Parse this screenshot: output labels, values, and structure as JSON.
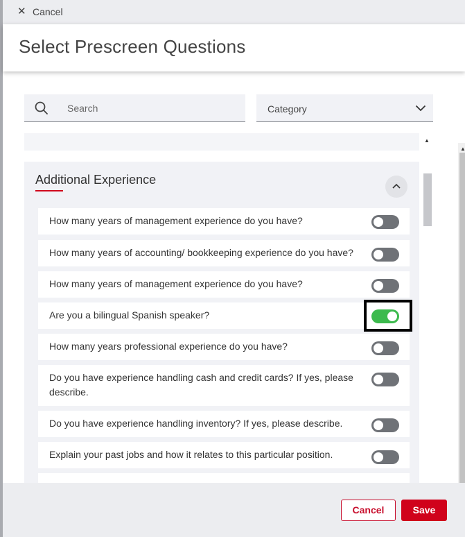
{
  "topbar": {
    "close_glyph": "✕",
    "cancel_label": "Cancel"
  },
  "header": {
    "title": "Select Prescreen Questions"
  },
  "filters": {
    "search_placeholder": "Search",
    "category_label": "Category"
  },
  "section": {
    "title": "Additional Experience",
    "questions": [
      {
        "text": "How many years of management experience do you have?",
        "enabled": false
      },
      {
        "text": "How many years of accounting/ bookkeeping experience do you have?",
        "enabled": false
      },
      {
        "text": "How many years of management experience do you have?",
        "enabled": false
      },
      {
        "text": "Are you a bilingual Spanish speaker?",
        "enabled": true
      },
      {
        "text": "How many years professional experience do you have?",
        "enabled": false
      },
      {
        "text": "Do you have experience handling cash and credit cards? If yes, please describe.",
        "enabled": false
      },
      {
        "text": "Do you have experience handling inventory? If yes, please describe.",
        "enabled": false
      },
      {
        "text": "Explain your past jobs and how it relates to this particular position.",
        "enabled": false
      }
    ]
  },
  "footer": {
    "cancel_label": "Cancel",
    "save_label": "Save"
  },
  "colors": {
    "accent": "#d0021b",
    "toggle_on": "#3cba4d",
    "toggle_off": "#6f7277"
  }
}
